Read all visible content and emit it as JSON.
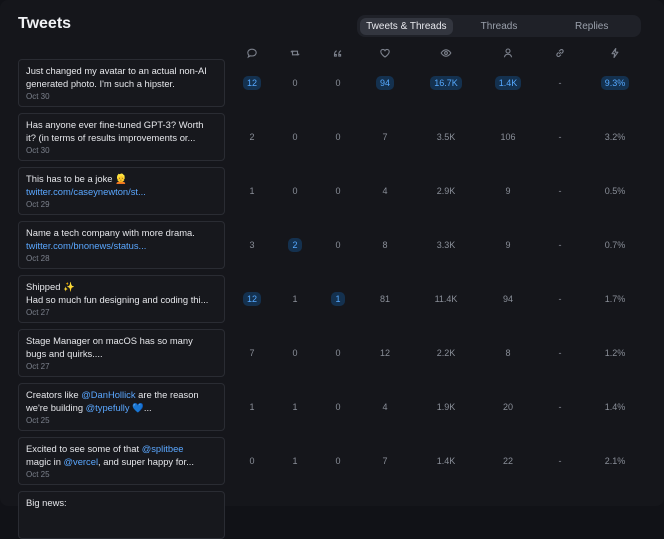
{
  "title": "Tweets",
  "tabs": [
    {
      "label": "Tweets & Threads",
      "active": true
    },
    {
      "label": "Threads",
      "active": false
    },
    {
      "label": "Replies",
      "active": false
    }
  ],
  "columns": [
    {
      "icon": "reply-icon"
    },
    {
      "icon": "retweet-icon"
    },
    {
      "icon": "quote-icon"
    },
    {
      "icon": "heart-icon"
    },
    {
      "icon": "eye-icon"
    },
    {
      "icon": "profile-icon"
    },
    {
      "icon": "link-icon"
    },
    {
      "icon": "bolt-icon"
    }
  ],
  "colors": {
    "highlight_bg": "#14314f",
    "highlight_text": "#56a9ff",
    "link": "#5aa7ff"
  },
  "rows": [
    {
      "lines": [
        {
          "parts": [
            {
              "t": "Just changed my avatar to an actual non-AI"
            }
          ]
        },
        {
          "parts": [
            {
              "t": "generated photo. I'm such a hipster."
            }
          ]
        }
      ],
      "date": "Oct 30",
      "cells": [
        {
          "v": "12",
          "hl": true
        },
        {
          "v": "0"
        },
        {
          "v": "0"
        },
        {
          "v": "94",
          "hl": true
        },
        {
          "v": "16.7K",
          "hl": true
        },
        {
          "v": "1.4K",
          "hl": true
        },
        {
          "v": "-"
        },
        {
          "v": "9.3%",
          "hl": true
        }
      ]
    },
    {
      "lines": [
        {
          "parts": [
            {
              "t": "Has anyone ever fine-tuned GPT-3? Worth"
            }
          ]
        },
        {
          "parts": [
            {
              "t": "it? (in terms of results improvements or..."
            }
          ]
        }
      ],
      "date": "Oct 30",
      "cells": [
        {
          "v": "2"
        },
        {
          "v": "0"
        },
        {
          "v": "0"
        },
        {
          "v": "7"
        },
        {
          "v": "3.5K"
        },
        {
          "v": "106"
        },
        {
          "v": "-"
        },
        {
          "v": "3.2%"
        }
      ]
    },
    {
      "lines": [
        {
          "parts": [
            {
              "t": "This has to be a joke 👱"
            }
          ]
        },
        {
          "parts": [
            {
              "t": "twitter.com/caseynewton/st...",
              "link": true
            }
          ]
        }
      ],
      "date": "Oct 29",
      "cells": [
        {
          "v": "1"
        },
        {
          "v": "0"
        },
        {
          "v": "0"
        },
        {
          "v": "4"
        },
        {
          "v": "2.9K"
        },
        {
          "v": "9"
        },
        {
          "v": "-"
        },
        {
          "v": "0.5%"
        }
      ]
    },
    {
      "lines": [
        {
          "parts": [
            {
              "t": "Name a tech company with more drama."
            }
          ]
        },
        {
          "parts": [
            {
              "t": "twitter.com/bnonews/status...",
              "link": true
            }
          ]
        }
      ],
      "date": "Oct 28",
      "cells": [
        {
          "v": "3"
        },
        {
          "v": "2",
          "hl": true
        },
        {
          "v": "0"
        },
        {
          "v": "8"
        },
        {
          "v": "3.3K"
        },
        {
          "v": "9"
        },
        {
          "v": "-"
        },
        {
          "v": "0.7%"
        }
      ]
    },
    {
      "lines": [
        {
          "parts": [
            {
              "t": "Shipped ✨"
            }
          ]
        },
        {
          "parts": [
            {
              "t": "Had so much fun designing and coding thi..."
            }
          ]
        }
      ],
      "date": "Oct 27",
      "cells": [
        {
          "v": "12",
          "hl": true
        },
        {
          "v": "1"
        },
        {
          "v": "1",
          "hl": true
        },
        {
          "v": "81"
        },
        {
          "v": "11.4K"
        },
        {
          "v": "94"
        },
        {
          "v": "-"
        },
        {
          "v": "1.7%"
        }
      ]
    },
    {
      "lines": [
        {
          "parts": [
            {
              "t": "Stage Manager on macOS has so many"
            }
          ]
        },
        {
          "parts": [
            {
              "t": "bugs and quirks...."
            }
          ]
        }
      ],
      "date": "Oct 27",
      "cells": [
        {
          "v": "7"
        },
        {
          "v": "0"
        },
        {
          "v": "0"
        },
        {
          "v": "12"
        },
        {
          "v": "2.2K"
        },
        {
          "v": "8"
        },
        {
          "v": "-"
        },
        {
          "v": "1.2%"
        }
      ]
    },
    {
      "lines": [
        {
          "parts": [
            {
              "t": "Creators like "
            },
            {
              "t": "@DanHollick",
              "link": true
            },
            {
              "t": " are the reason"
            }
          ]
        },
        {
          "parts": [
            {
              "t": "we're building "
            },
            {
              "t": "@typefully",
              "link": true
            },
            {
              "t": " 💙..."
            }
          ]
        }
      ],
      "date": "Oct 25",
      "cells": [
        {
          "v": "1"
        },
        {
          "v": "1"
        },
        {
          "v": "0"
        },
        {
          "v": "4"
        },
        {
          "v": "1.9K"
        },
        {
          "v": "20"
        },
        {
          "v": "-"
        },
        {
          "v": "1.4%"
        }
      ]
    },
    {
      "lines": [
        {
          "parts": [
            {
              "t": "Excited to see some of that "
            },
            {
              "t": "@splitbee",
              "link": true
            }
          ]
        },
        {
          "parts": [
            {
              "t": "magic in "
            },
            {
              "t": "@vercel",
              "link": true
            },
            {
              "t": ", and super happy for..."
            }
          ]
        }
      ],
      "date": "Oct 25",
      "cells": [
        {
          "v": "0"
        },
        {
          "v": "1"
        },
        {
          "v": "0"
        },
        {
          "v": "7"
        },
        {
          "v": "1.4K"
        },
        {
          "v": "22"
        },
        {
          "v": "-"
        },
        {
          "v": "2.1%"
        }
      ]
    },
    {
      "lines": [
        {
          "parts": [
            {
              "t": "Big news:"
            }
          ]
        }
      ],
      "date": "",
      "cells": []
    }
  ]
}
